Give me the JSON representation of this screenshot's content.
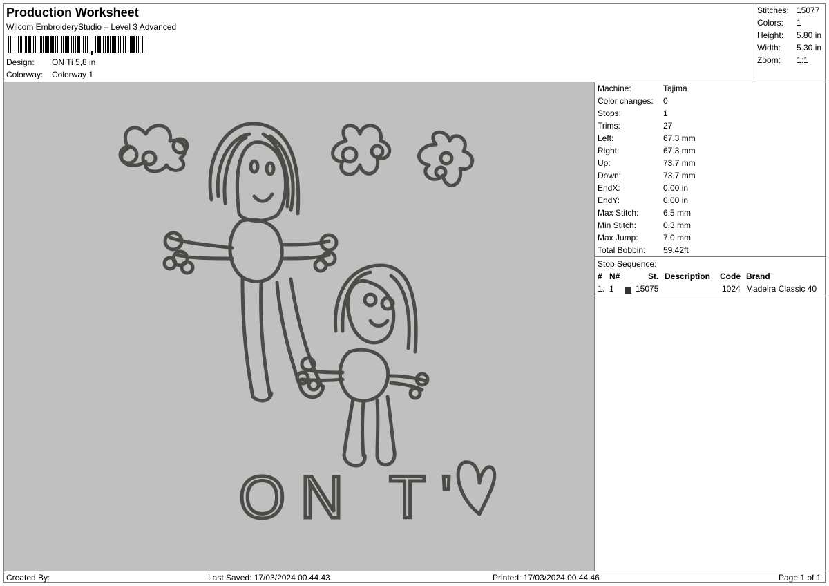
{
  "header": {
    "title": "Production Worksheet",
    "subtitle": "Wilcom EmbroideryStudio – Level 3 Advanced",
    "design_label": "Design:",
    "design_value": "ON Ti 5,8 in",
    "colorway_label": "Colorway:",
    "colorway_value": "Colorway 1"
  },
  "summary": {
    "stitches_label": "Stitches:",
    "stitches_value": "15077",
    "colors_label": "Colors:",
    "colors_value": "1",
    "height_label": "Height:",
    "height_value": "5.80 in",
    "width_label": "Width:",
    "width_value": "5.30 in",
    "zoom_label": "Zoom:",
    "zoom_value": "1:1"
  },
  "machine": {
    "machine_label": "Machine:",
    "machine_value": "Tajima",
    "color_changes_label": "Color changes:",
    "color_changes_value": "0",
    "stops_label": "Stops:",
    "stops_value": "1",
    "trims_label": "Trims:",
    "trims_value": "27",
    "left_label": "Left:",
    "left_value": "67.3 mm",
    "right_label": "Right:",
    "right_value": "67.3 mm",
    "up_label": "Up:",
    "up_value": "73.7 mm",
    "down_label": "Down:",
    "down_value": "73.7 mm",
    "endx_label": "EndX:",
    "endx_value": "0.00 in",
    "endy_label": "EndY:",
    "endy_value": "0.00 in",
    "max_stitch_label": "Max Stitch:",
    "max_stitch_value": "6.5 mm",
    "min_stitch_label": "Min Stitch:",
    "min_stitch_value": "0.3 mm",
    "max_jump_label": "Max Jump:",
    "max_jump_value": "7.0 mm",
    "total_bobbin_label": "Total Bobbin:",
    "total_bobbin_value": "59.42ft"
  },
  "stop_sequence": {
    "label": "Stop Sequence:",
    "headers": {
      "num": "#",
      "n": "N#",
      "st": "St.",
      "description": "Description",
      "code": "Code",
      "brand": "Brand"
    },
    "rows": [
      {
        "num": "1.",
        "n": "1",
        "color": "#333333",
        "st": "15075",
        "description": "",
        "code": "1024",
        "brand": "Madeira Classic 40"
      }
    ]
  },
  "design_text": "ON T'",
  "footer": {
    "created_by": "Created By:",
    "last_saved": "Last Saved: 17/03/2024 00.44.43",
    "printed": "Printed: 17/03/2024 00.44.46",
    "page": "Page 1 of 1"
  },
  "colors": {
    "thread": "#4a4d47",
    "preview_bg": "#c0c0c0"
  }
}
